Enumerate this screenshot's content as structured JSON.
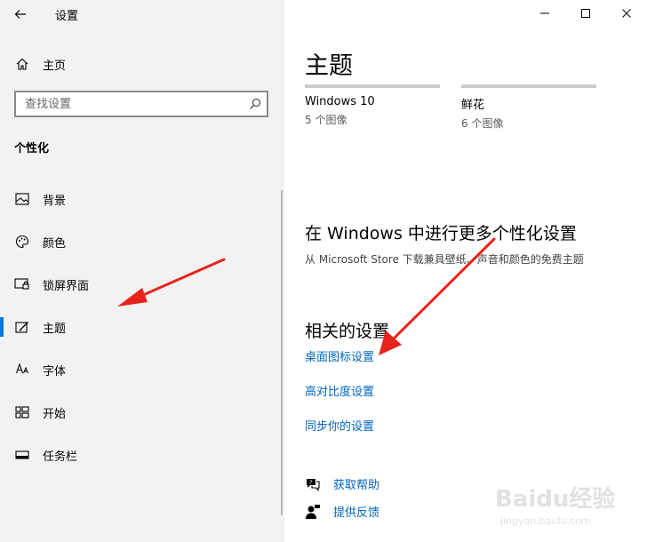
{
  "window": {
    "title": "设置"
  },
  "sidebar": {
    "home_label": "主页",
    "search_placeholder": "查找设置",
    "section_title": "个性化",
    "items": [
      {
        "label": "背景",
        "icon": "image-icon"
      },
      {
        "label": "颜色",
        "icon": "palette-icon"
      },
      {
        "label": "锁屏界面",
        "icon": "lock-screen-icon"
      },
      {
        "label": "主题",
        "icon": "theme-brush-icon",
        "selected": true
      },
      {
        "label": "字体",
        "icon": "font-icon"
      },
      {
        "label": "开始",
        "icon": "start-grid-icon"
      },
      {
        "label": "任务栏",
        "icon": "taskbar-icon"
      }
    ]
  },
  "main": {
    "heading": "主题",
    "themes": [
      {
        "name": "Windows 10",
        "count": "5 个图像"
      },
      {
        "name": "鲜花",
        "count": "6 个图像"
      }
    ],
    "more_heading": "在 Windows 中进行更多个性化设置",
    "more_sub": "从 Microsoft Store 下载兼具壁纸、声音和颜色的免费主题",
    "related_heading": "相关的设置",
    "related_links": [
      "桌面图标设置",
      "高对比度设置",
      "同步你的设置"
    ],
    "help": {
      "get_help": "获取帮助",
      "feedback": "提供反馈"
    }
  },
  "watermark": {
    "brand": "Baidu经验",
    "domain": "jingyan.baidu.com"
  },
  "colors": {
    "accent": "#0078d7",
    "link": "#0067c0",
    "sidebar_bg": "#f2f2f2",
    "arrow": "#e8231d"
  }
}
